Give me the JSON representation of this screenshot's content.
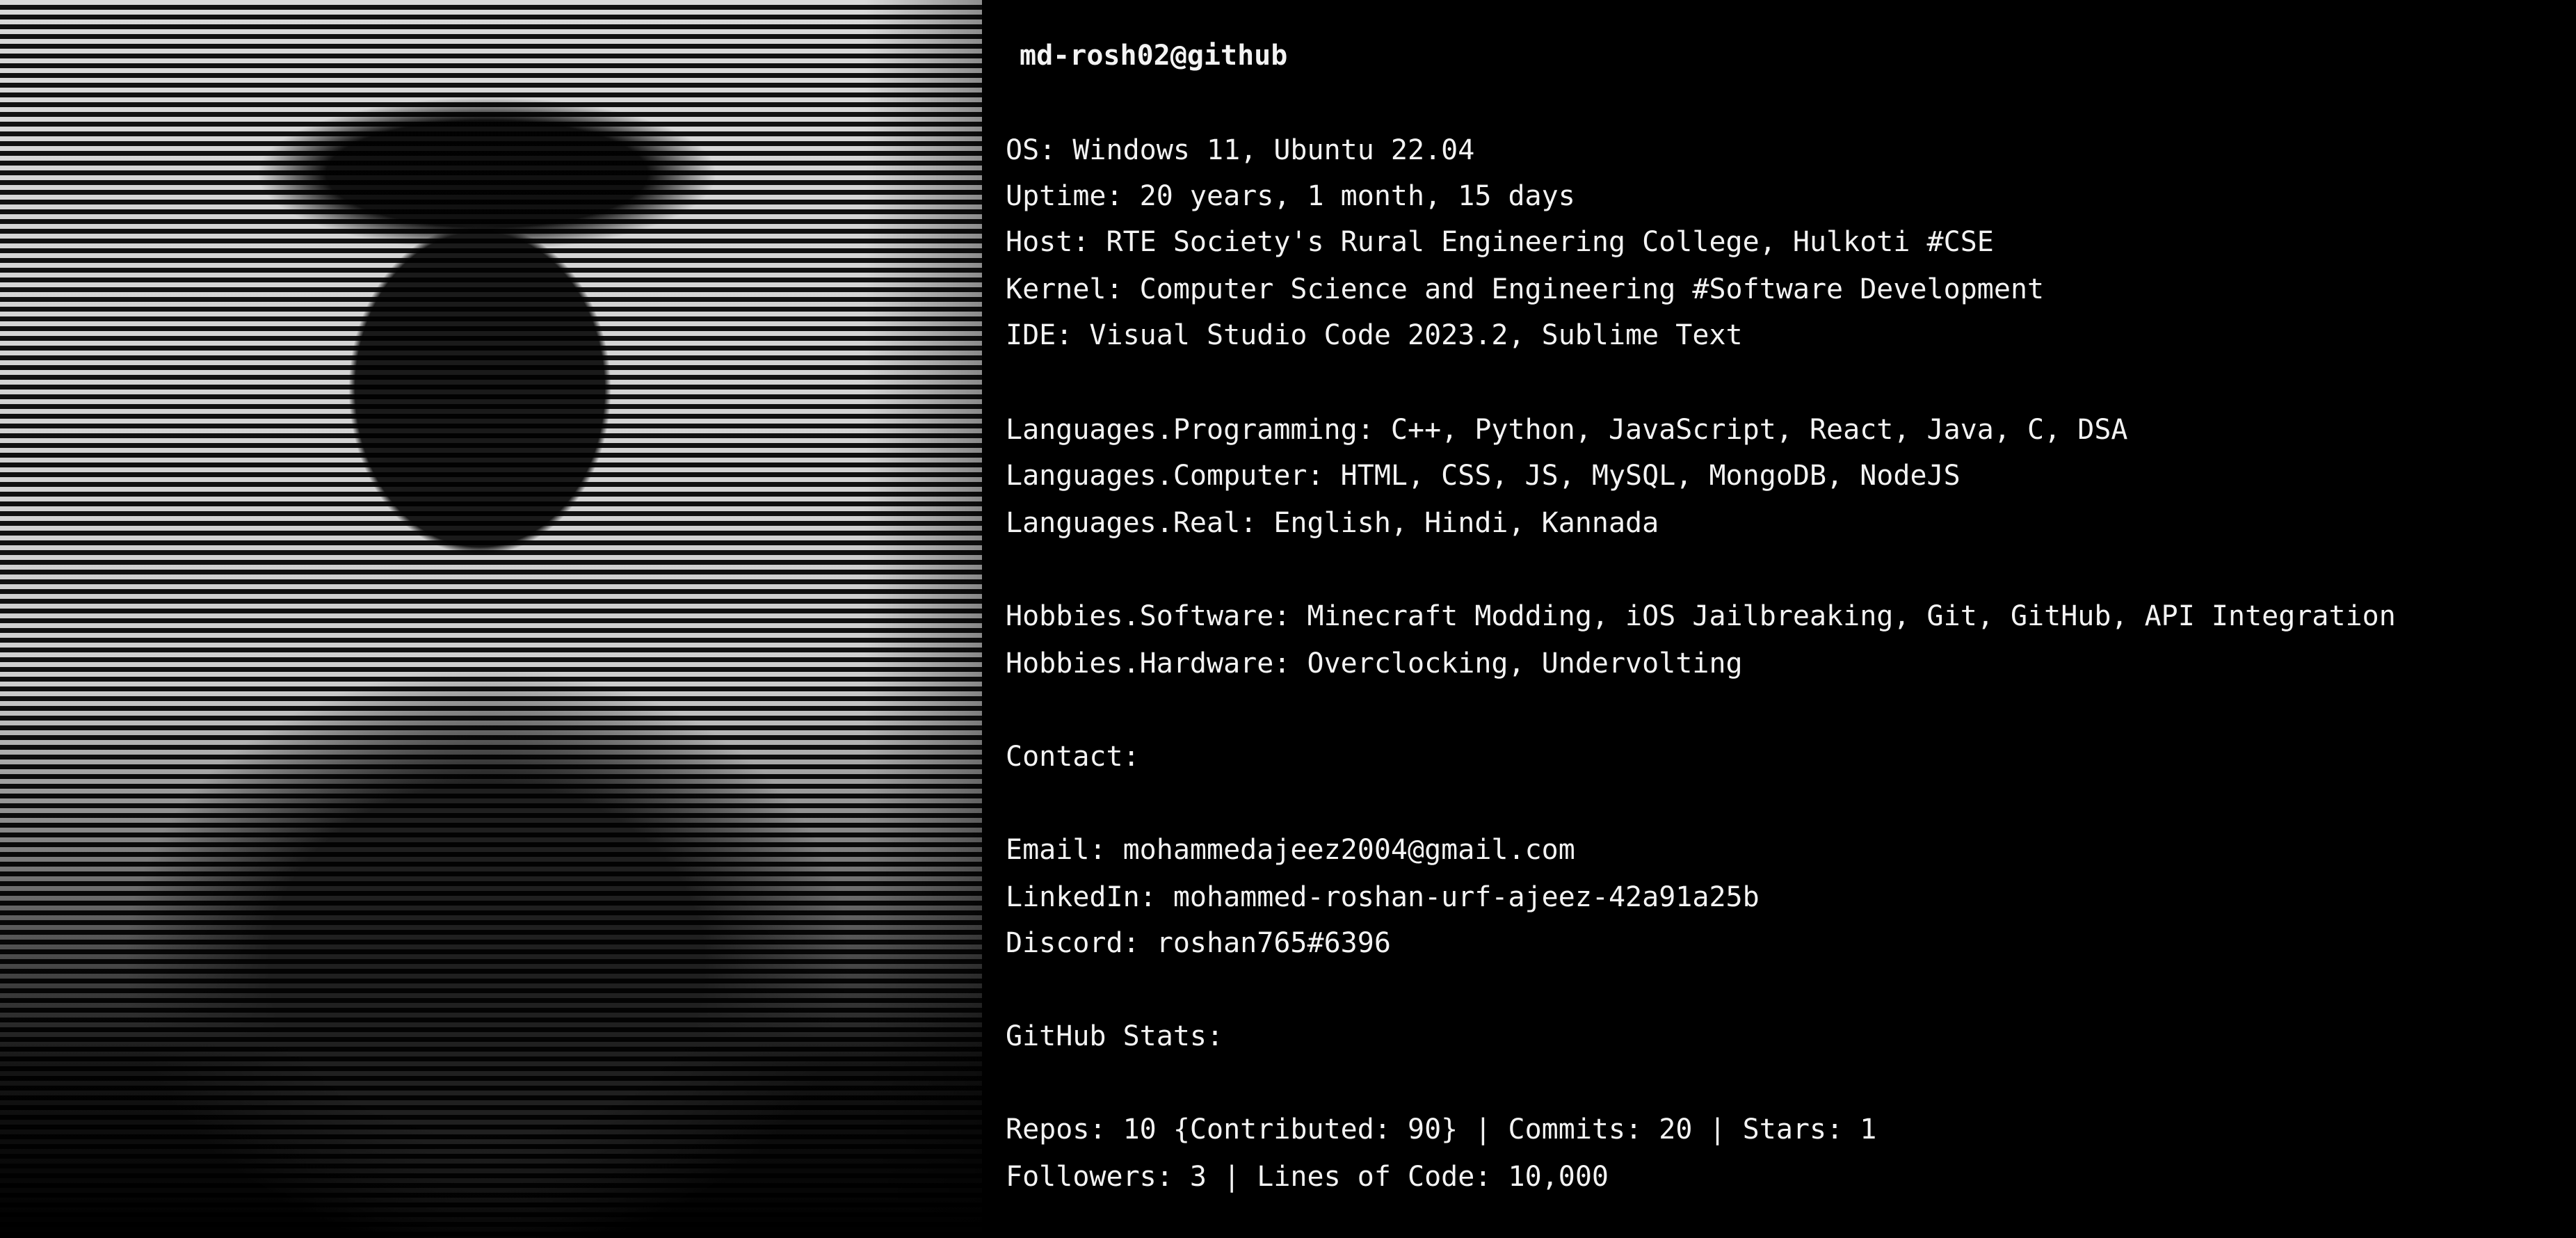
{
  "user_host": "md-rosh02@github",
  "info": [
    {
      "key": "OS:",
      "value": "Windows 11, Ubuntu 22.04"
    },
    {
      "key": "Uptime:",
      "value": "20 years, 1 month, 15 days"
    },
    {
      "key": "Host:",
      "value": "RTE Society's Rural Engineering College, Hulkoti #CSE"
    },
    {
      "key": "Kernel:",
      "value": "Computer Science and Engineering #Software Development"
    },
    {
      "key": "IDE:",
      "value": "Visual Studio Code 2023.2, Sublime Text"
    },
    {
      "key": "Languages.Programming:",
      "value": "C++, Python, JavaScript, React, Java, C, DSA"
    },
    {
      "key": "Languages.Computer:",
      "value": "HTML, CSS, JS, MySQL, MongoDB, NodeJS"
    },
    {
      "key": "Languages.Real:",
      "value": "English, Hindi, Kannada"
    },
    {
      "key": "Hobbies.Software:",
      "value": "Minecraft Modding, iOS Jailbreaking, Git, GitHub, API Integration"
    },
    {
      "key": "Hobbies.Hardware:",
      "value": "Overclocking, Undervolting"
    }
  ],
  "contact": {
    "heading": "Contact:",
    "email_key": "Email:",
    "email": "mohammedajeez2004@gmail.com",
    "linkedin_key": "LinkedIn:",
    "linkedin": "mohammed-roshan-urf-ajeez-42a91a25b",
    "discord_key": "Discord:",
    "discord": "roshan765#6396"
  },
  "stats": {
    "heading": "GitHub Stats:",
    "repos_key": "Repos:",
    "repos_value": "10 {Contributed: 90}",
    "commits_key": "Commits:",
    "commits_value": "20",
    "stars_key": "Stars:",
    "stars_value": "1",
    "followers_key": "Followers:",
    "followers_value": "3",
    "loc_key": "Lines of Code:",
    "loc_value": "10,000",
    "separator": " | "
  },
  "portrait": {
    "icon": "ascii-portrait-image"
  }
}
